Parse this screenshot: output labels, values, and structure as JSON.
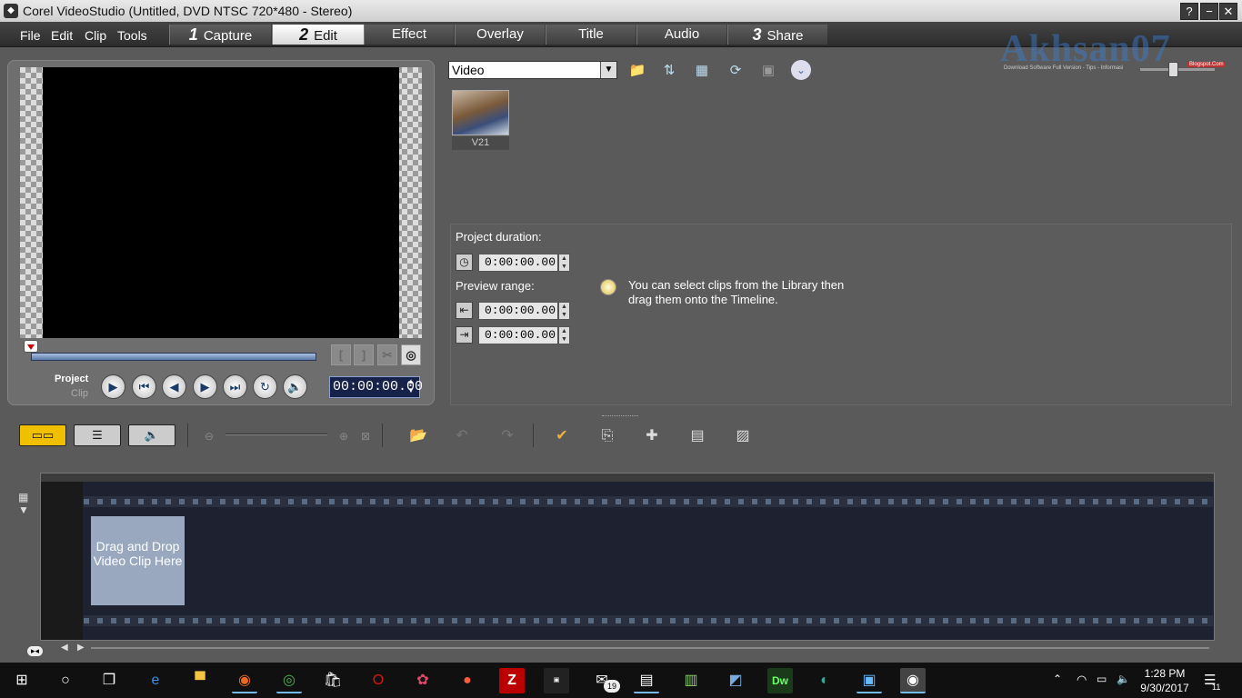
{
  "window": {
    "title": "Corel VideoStudio (Untitled, DVD NTSC 720*480 - Stereo)",
    "help_label": "?",
    "min_label": "−",
    "close_label": "✕"
  },
  "menu": [
    "File",
    "Edit",
    "Clip",
    "Tools"
  ],
  "steps": [
    {
      "num": "1",
      "label": "Capture"
    },
    {
      "num": "2",
      "label": "Edit"
    },
    {
      "num": "",
      "label": "Effect"
    },
    {
      "num": "",
      "label": "Overlay"
    },
    {
      "num": "",
      "label": "Title"
    },
    {
      "num": "",
      "label": "Audio"
    },
    {
      "num": "3",
      "label": "Share"
    }
  ],
  "player": {
    "project_label": "Project",
    "clip_label": "Clip",
    "timecode": "00:00:00.00"
  },
  "library": {
    "category": "Video",
    "clip": "V21"
  },
  "watermark": {
    "logo": "Akhsan07",
    "tagline": "Download Software Full Version - Tips - Informasi",
    "badge": "Blogspot.Com"
  },
  "options": {
    "project_duration_label": "Project duration:",
    "project_duration": "0:00:00.00",
    "preview_range_label": "Preview range:",
    "range_start": "0:00:00.00",
    "range_end": "0:00:00.00",
    "tip": "You can select clips from the Library then drag them onto the Timeline."
  },
  "timeline": {
    "drop_text": "Drag and Drop Video Clip Here"
  },
  "taskbar": {
    "time": "1:28 PM",
    "date": "9/30/2017",
    "mail_count": "19",
    "notif_count": "11"
  },
  "colors": {
    "accent": "#3a7fd5",
    "active_view": "#f0c000"
  }
}
